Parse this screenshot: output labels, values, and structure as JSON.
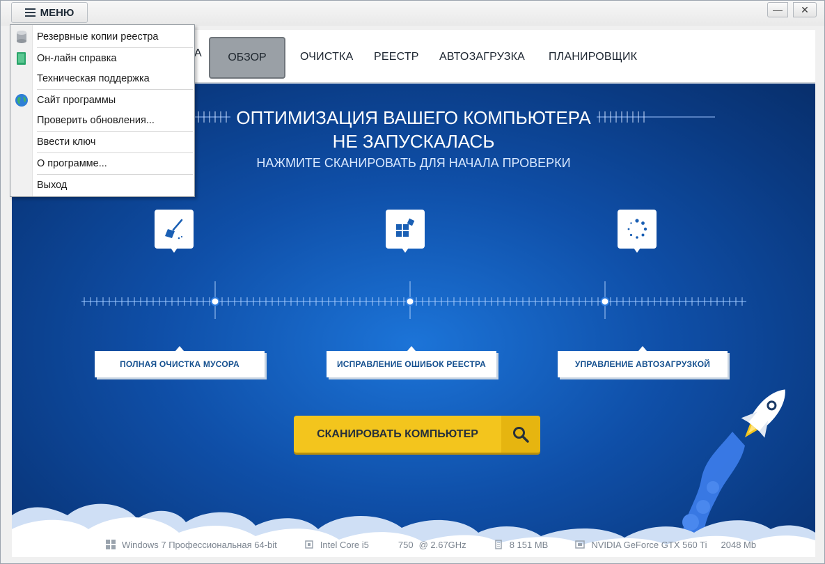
{
  "titlebar": {
    "menu_label": "МЕНЮ",
    "minimize_glyph": "—",
    "close_glyph": "✕"
  },
  "nav": {
    "hidden_partial": "А",
    "active": "ОБЗОР",
    "items": [
      "ОЧИСТКА",
      "РЕЕСТР",
      "АВТОЗАГРУЗКА",
      "ПЛАНИРОВЩИК"
    ]
  },
  "hero": {
    "title_line1": "ОПТИМИЗАЦИЯ ВАШЕГО КОМПЬЮТЕРА",
    "title_line2": "НЕ ЗАПУСКАЛАСЬ",
    "subtitle": "НАЖМИТЕ СКАНИРОВАТЬ ДЛЯ НАЧАЛА ПРОВЕРКИ"
  },
  "features": [
    {
      "icon": "broom-icon",
      "label": "ПОЛНАЯ ОЧИСТКА МУСОРА"
    },
    {
      "icon": "registry-blocks-icon",
      "label": "ИСПРАВЛЕНИЕ ОШИБОК РЕЕСТРА"
    },
    {
      "icon": "dotted-circle-icon",
      "label": "УПРАВЛЕНИЕ АВТОЗАГРУЗКОЙ"
    }
  ],
  "scan_button": {
    "label": "СКАНИРОВАТЬ КОМПЬЮТЕР",
    "icon": "search-icon"
  },
  "status": {
    "os": "Windows 7 Профессиональная 64-bit",
    "cpu": "Intel Core i5",
    "cpu_model": "750",
    "cpu_freq": "@ 2.67GHz",
    "ram": "8 151 MB",
    "gpu": "NVIDIA GeForce GTX 560 Ti",
    "vram": "2048 Mb"
  },
  "menu": {
    "items": [
      {
        "label": "Резервные копии реестра",
        "icon": "database-icon"
      },
      {
        "label": "Он-лайн справка",
        "icon": "book-icon"
      },
      {
        "label": "Техническая поддержка",
        "icon": ""
      },
      {
        "label": "Сайт программы",
        "icon": "globe-icon"
      },
      {
        "label": "Проверить обновления...",
        "icon": ""
      },
      {
        "label": "Ввести ключ",
        "icon": ""
      },
      {
        "label": "О программе...",
        "icon": ""
      },
      {
        "label": "Выход",
        "icon": ""
      }
    ]
  },
  "colors": {
    "accent_yellow": "#f3c51d",
    "main_blue": "#0f4fa8",
    "label_blue": "#15508f"
  }
}
